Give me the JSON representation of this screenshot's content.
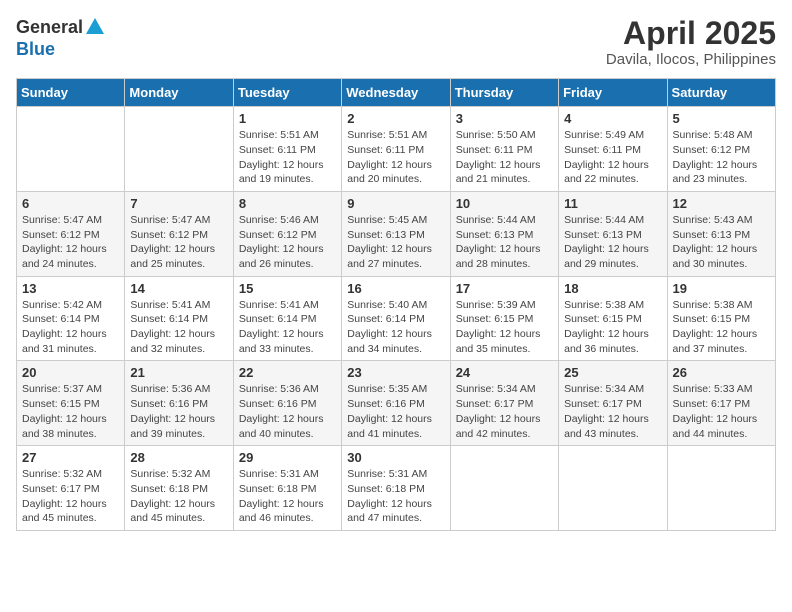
{
  "header": {
    "logo_general": "General",
    "logo_blue": "Blue",
    "month": "April 2025",
    "location": "Davila, Ilocos, Philippines"
  },
  "weekdays": [
    "Sunday",
    "Monday",
    "Tuesday",
    "Wednesday",
    "Thursday",
    "Friday",
    "Saturday"
  ],
  "weeks": [
    [
      {
        "day": "",
        "sunrise": "",
        "sunset": "",
        "daylight": ""
      },
      {
        "day": "",
        "sunrise": "",
        "sunset": "",
        "daylight": ""
      },
      {
        "day": "1",
        "sunrise": "Sunrise: 5:51 AM",
        "sunset": "Sunset: 6:11 PM",
        "daylight": "Daylight: 12 hours and 19 minutes."
      },
      {
        "day": "2",
        "sunrise": "Sunrise: 5:51 AM",
        "sunset": "Sunset: 6:11 PM",
        "daylight": "Daylight: 12 hours and 20 minutes."
      },
      {
        "day": "3",
        "sunrise": "Sunrise: 5:50 AM",
        "sunset": "Sunset: 6:11 PM",
        "daylight": "Daylight: 12 hours and 21 minutes."
      },
      {
        "day": "4",
        "sunrise": "Sunrise: 5:49 AM",
        "sunset": "Sunset: 6:11 PM",
        "daylight": "Daylight: 12 hours and 22 minutes."
      },
      {
        "day": "5",
        "sunrise": "Sunrise: 5:48 AM",
        "sunset": "Sunset: 6:12 PM",
        "daylight": "Daylight: 12 hours and 23 minutes."
      }
    ],
    [
      {
        "day": "6",
        "sunrise": "Sunrise: 5:47 AM",
        "sunset": "Sunset: 6:12 PM",
        "daylight": "Daylight: 12 hours and 24 minutes."
      },
      {
        "day": "7",
        "sunrise": "Sunrise: 5:47 AM",
        "sunset": "Sunset: 6:12 PM",
        "daylight": "Daylight: 12 hours and 25 minutes."
      },
      {
        "day": "8",
        "sunrise": "Sunrise: 5:46 AM",
        "sunset": "Sunset: 6:12 PM",
        "daylight": "Daylight: 12 hours and 26 minutes."
      },
      {
        "day": "9",
        "sunrise": "Sunrise: 5:45 AM",
        "sunset": "Sunset: 6:13 PM",
        "daylight": "Daylight: 12 hours and 27 minutes."
      },
      {
        "day": "10",
        "sunrise": "Sunrise: 5:44 AM",
        "sunset": "Sunset: 6:13 PM",
        "daylight": "Daylight: 12 hours and 28 minutes."
      },
      {
        "day": "11",
        "sunrise": "Sunrise: 5:44 AM",
        "sunset": "Sunset: 6:13 PM",
        "daylight": "Daylight: 12 hours and 29 minutes."
      },
      {
        "day": "12",
        "sunrise": "Sunrise: 5:43 AM",
        "sunset": "Sunset: 6:13 PM",
        "daylight": "Daylight: 12 hours and 30 minutes."
      }
    ],
    [
      {
        "day": "13",
        "sunrise": "Sunrise: 5:42 AM",
        "sunset": "Sunset: 6:14 PM",
        "daylight": "Daylight: 12 hours and 31 minutes."
      },
      {
        "day": "14",
        "sunrise": "Sunrise: 5:41 AM",
        "sunset": "Sunset: 6:14 PM",
        "daylight": "Daylight: 12 hours and 32 minutes."
      },
      {
        "day": "15",
        "sunrise": "Sunrise: 5:41 AM",
        "sunset": "Sunset: 6:14 PM",
        "daylight": "Daylight: 12 hours and 33 minutes."
      },
      {
        "day": "16",
        "sunrise": "Sunrise: 5:40 AM",
        "sunset": "Sunset: 6:14 PM",
        "daylight": "Daylight: 12 hours and 34 minutes."
      },
      {
        "day": "17",
        "sunrise": "Sunrise: 5:39 AM",
        "sunset": "Sunset: 6:15 PM",
        "daylight": "Daylight: 12 hours and 35 minutes."
      },
      {
        "day": "18",
        "sunrise": "Sunrise: 5:38 AM",
        "sunset": "Sunset: 6:15 PM",
        "daylight": "Daylight: 12 hours and 36 minutes."
      },
      {
        "day": "19",
        "sunrise": "Sunrise: 5:38 AM",
        "sunset": "Sunset: 6:15 PM",
        "daylight": "Daylight: 12 hours and 37 minutes."
      }
    ],
    [
      {
        "day": "20",
        "sunrise": "Sunrise: 5:37 AM",
        "sunset": "Sunset: 6:15 PM",
        "daylight": "Daylight: 12 hours and 38 minutes."
      },
      {
        "day": "21",
        "sunrise": "Sunrise: 5:36 AM",
        "sunset": "Sunset: 6:16 PM",
        "daylight": "Daylight: 12 hours and 39 minutes."
      },
      {
        "day": "22",
        "sunrise": "Sunrise: 5:36 AM",
        "sunset": "Sunset: 6:16 PM",
        "daylight": "Daylight: 12 hours and 40 minutes."
      },
      {
        "day": "23",
        "sunrise": "Sunrise: 5:35 AM",
        "sunset": "Sunset: 6:16 PM",
        "daylight": "Daylight: 12 hours and 41 minutes."
      },
      {
        "day": "24",
        "sunrise": "Sunrise: 5:34 AM",
        "sunset": "Sunset: 6:17 PM",
        "daylight": "Daylight: 12 hours and 42 minutes."
      },
      {
        "day": "25",
        "sunrise": "Sunrise: 5:34 AM",
        "sunset": "Sunset: 6:17 PM",
        "daylight": "Daylight: 12 hours and 43 minutes."
      },
      {
        "day": "26",
        "sunrise": "Sunrise: 5:33 AM",
        "sunset": "Sunset: 6:17 PM",
        "daylight": "Daylight: 12 hours and 44 minutes."
      }
    ],
    [
      {
        "day": "27",
        "sunrise": "Sunrise: 5:32 AM",
        "sunset": "Sunset: 6:17 PM",
        "daylight": "Daylight: 12 hours and 45 minutes."
      },
      {
        "day": "28",
        "sunrise": "Sunrise: 5:32 AM",
        "sunset": "Sunset: 6:18 PM",
        "daylight": "Daylight: 12 hours and 45 minutes."
      },
      {
        "day": "29",
        "sunrise": "Sunrise: 5:31 AM",
        "sunset": "Sunset: 6:18 PM",
        "daylight": "Daylight: 12 hours and 46 minutes."
      },
      {
        "day": "30",
        "sunrise": "Sunrise: 5:31 AM",
        "sunset": "Sunset: 6:18 PM",
        "daylight": "Daylight: 12 hours and 47 minutes."
      },
      {
        "day": "",
        "sunrise": "",
        "sunset": "",
        "daylight": ""
      },
      {
        "day": "",
        "sunrise": "",
        "sunset": "",
        "daylight": ""
      },
      {
        "day": "",
        "sunrise": "",
        "sunset": "",
        "daylight": ""
      }
    ]
  ]
}
